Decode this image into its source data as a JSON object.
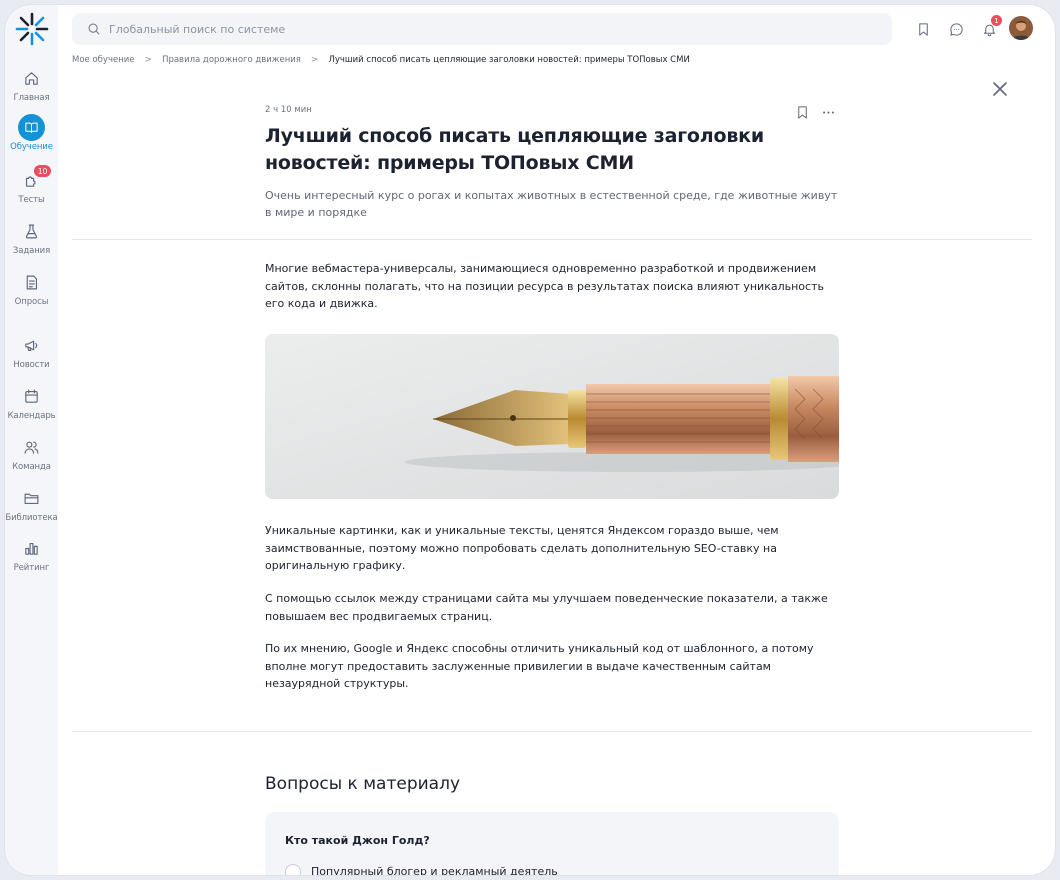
{
  "search": {
    "placeholder": "Глобальный поиск по системе"
  },
  "sidebar": {
    "items": [
      {
        "label": "Главная",
        "icon": "home-icon"
      },
      {
        "label": "Обучение",
        "icon": "book-icon",
        "active": true
      },
      {
        "label": "Тесты",
        "icon": "puzzle-icon",
        "badge": "10"
      },
      {
        "label": "Задания",
        "icon": "flask-icon"
      },
      {
        "label": "Опросы",
        "icon": "poll-icon"
      },
      {
        "label": "Новости",
        "icon": "megaphone-icon"
      },
      {
        "label": "Календарь",
        "icon": "calendar-icon"
      },
      {
        "label": "Команда",
        "icon": "team-icon"
      },
      {
        "label": "Библиотека",
        "icon": "folder-icon"
      },
      {
        "label": "Рейтинг",
        "icon": "chart-icon"
      }
    ]
  },
  "topbar": {
    "notifications_count": "1"
  },
  "breadcrumb": {
    "items": [
      "Мое обучение",
      "Правила дорожного движения"
    ],
    "current": "Лучший способ писать цепляющие заголовки новостей: примеры ТОПовых СМИ",
    "separator": ">"
  },
  "article": {
    "duration": "2 ч 10 мин",
    "title": "Лучший способ писать цепляющие заголовки новостей: примеры ТОПовых СМИ",
    "subtitle": "Очень интересный курс о рогах и копытах животных в естественной среде, где животные живут в мире и порядке",
    "intro": "Многие вебмастера-универсалы, занимающиеся одновременно разработкой и продвижением сайтов, склонны полагать, что на позиции ресурса в результатах поиска влияют уникальность его кода и движка.",
    "paragraphs": [
      "Уникальные картинки, как и уникальные тексты, ценятся Яндексом гораздо выше, чем заимствованные, поэтому можно попробовать сделать дополнительную SEO-ставку на оригинальную графику.",
      "С помощью ссылок между страницами сайта мы улучшаем поведенческие показатели, а также повышаем вес продвигаемых страниц.",
      "По их мнению, Google и Яндекс способны отличить уникальный код от шаблонного, а потому вполне могут предоставить заслуженные привилегии в выдаче качественным сайтам незаурядной структуры."
    ]
  },
  "questions": {
    "title": "Вопросы к материалу",
    "items": [
      {
        "question": "Кто такой Джон Голд?",
        "option": "Популярный блогер и рекламный деятель"
      }
    ]
  },
  "colors": {
    "accent": "#1592d6",
    "badge": "#ef4b5e",
    "sidebar_bg": "#f4f6f9"
  }
}
